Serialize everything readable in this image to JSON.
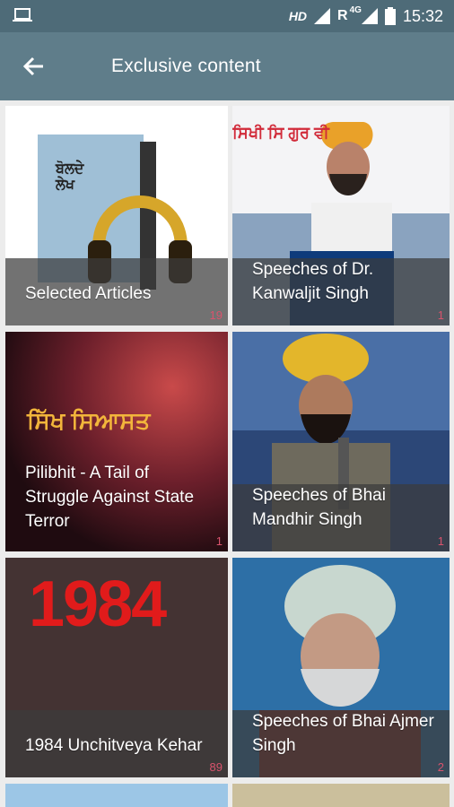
{
  "status_bar": {
    "network_hd": "HD",
    "network_r": "R",
    "network_4g": "4G",
    "time": "15:32"
  },
  "app_bar": {
    "title": "Exclusive content"
  },
  "tiles": [
    {
      "caption": "Selected Articles",
      "count": "19",
      "art_text": "ਬੋਲਦੇ\nਲੇਖ"
    },
    {
      "caption": "Speeches of Dr. Kanwaljit Singh",
      "count": "1",
      "art_text": "ਸਿਖੀ ਸਿ ਗੁਰ ਵੀ"
    },
    {
      "caption": "Pilibhit - A Tail of Struggle Against State Terror",
      "count": "1",
      "art_text": "ਸਿੱਖ ਸਿਆਸਤ"
    },
    {
      "caption": "Speeches of Bhai Mandhir Singh",
      "count": "1",
      "art_text": ""
    },
    {
      "caption": "1984 Unchitveya Kehar",
      "count": "89",
      "art_text": "1984"
    },
    {
      "caption": "Speeches of Bhai Ajmer Singh",
      "count": "2",
      "art_text": ""
    }
  ]
}
